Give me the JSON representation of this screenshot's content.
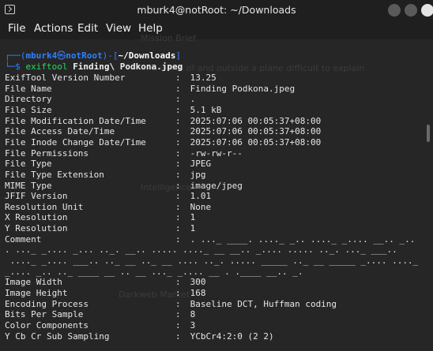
{
  "window": {
    "title": "mburk4@notRoot: ~/Downloads",
    "controls": [
      "minimize",
      "maximize",
      "close"
    ]
  },
  "menu": [
    "File",
    "Actions",
    "Edit",
    "View",
    "Help"
  ],
  "prompt": {
    "user": "mburk4",
    "symbol": "㉿",
    "host": "notRoot",
    "dir": "~/Downloads",
    "command": "exiftool",
    "argument": "Finding\\ Podkona.jpeg"
  },
  "exif": [
    {
      "key": "ExifTool Version Number",
      "value": "13.25"
    },
    {
      "key": "File Name",
      "value": "Finding Podkona.jpeg"
    },
    {
      "key": "Directory",
      "value": "."
    },
    {
      "key": "File Size",
      "value": "5.1 kB"
    },
    {
      "key": "File Modification Date/Time",
      "value": "2025:07:06 00:05:37+08:00"
    },
    {
      "key": "File Access Date/Time",
      "value": "2025:07:06 00:05:37+08:00"
    },
    {
      "key": "File Inode Change Date/Time",
      "value": "2025:07:06 00:05:37+08:00"
    },
    {
      "key": "File Permissions",
      "value": "-rw-rw-r--"
    },
    {
      "key": "File Type",
      "value": "JPEG"
    },
    {
      "key": "File Type Extension",
      "value": "jpg"
    },
    {
      "key": "MIME Type",
      "value": "image/jpeg"
    },
    {
      "key": "JFIF Version",
      "value": "1.01"
    },
    {
      "key": "Resolution Unit",
      "value": "None"
    },
    {
      "key": "X Resolution",
      "value": "1"
    },
    {
      "key": "Y Resolution",
      "value": "1"
    },
    {
      "key": "Comment",
      "value": ". ..._ ____. ...._ _.. ...._ _.... __.. _.."
    }
  ],
  "comment_continuation": [
    ". ..._ _.... _... .._. __.. ..... ...._ __ __.. _.... ..... .._. ..._ ___..",
    " ...._ _.... ___.. .._ __ .._ __ .... .._. ..... _____ .._ __ _____ _.... ...._",
    "_.... _.. .._ ____ __ .. __ ..._ _.... __ . .____ __.. _."
  ],
  "exif_after": [
    {
      "key": "Image Width",
      "value": "300"
    },
    {
      "key": "Image Height",
      "value": "168"
    },
    {
      "key": "Encoding Process",
      "value": "Baseline DCT, Huffman coding"
    },
    {
      "key": "Bits Per Sample",
      "value": "8"
    },
    {
      "key": "Color Components",
      "value": "3"
    },
    {
      "key": "Y Cb Cr Sub Sampling",
      "value": "YCbCr4:2:0 (2 2)"
    }
  ],
  "background_ghost": {
    "mission_brief": "Mission Brief",
    "mission_text": "In a world of and outside a plane difficult to explain",
    "intelligence": "Intelligence",
    "darkweb": "Darkweb Market"
  },
  "colors": {
    "prompt_blue": "#2f80ff",
    "command_green": "#1ee05a",
    "text": "#e6e6e6",
    "background": "#262626"
  }
}
